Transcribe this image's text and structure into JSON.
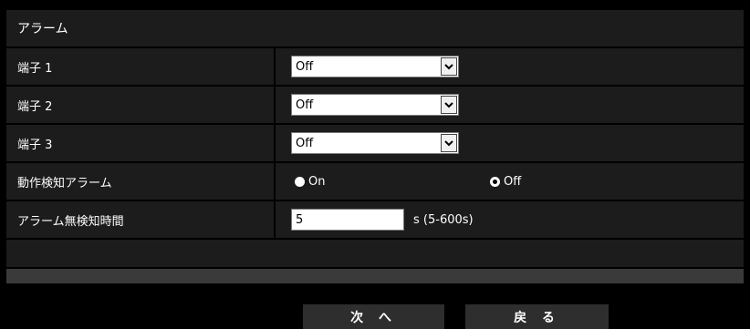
{
  "section_title": "アラーム",
  "rows": [
    {
      "label": "端子 1",
      "value": "Off"
    },
    {
      "label": "端子 2",
      "value": "Off"
    },
    {
      "label": "端子 3",
      "value": "Off"
    }
  ],
  "motion": {
    "label": "動作検知アラーム",
    "options": [
      {
        "label": "On",
        "selected": false
      },
      {
        "label": "Off",
        "selected": true
      }
    ]
  },
  "no_detect": {
    "label": "アラーム無検知時間",
    "value": "5",
    "unit": "s (5-600s)"
  },
  "buttons": {
    "next": "次 へ",
    "back": "戻 る"
  }
}
